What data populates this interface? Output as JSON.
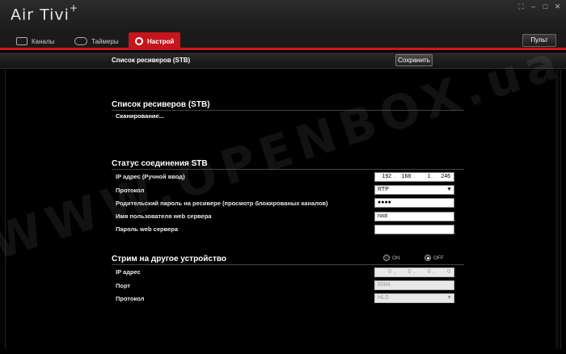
{
  "app": {
    "title": "Air Tivi",
    "title_sup": "+"
  },
  "window_controls": [
    "fullscreen-icon",
    "minimize-icon",
    "maximize-icon",
    "close-icon"
  ],
  "tabs": [
    {
      "label": "Каналы",
      "icon": "tv-icon",
      "active": false
    },
    {
      "label": "Таймеры",
      "icon": "timer-icon",
      "active": false
    },
    {
      "label": "Настрой",
      "icon": "gear-icon",
      "active": true
    }
  ],
  "remote_button": "Пульт",
  "subheader": {
    "title": "Список  ресиверов (STB)",
    "save_label": "Сохранить"
  },
  "receivers": {
    "title": "Список  ресиверов (STB)",
    "status": "Сканирование..."
  },
  "stb_status": {
    "title": "Статус соединения STB",
    "ip_label": "IP адрес (Ручной ввод)",
    "ip": [
      "192",
      "168",
      "1",
      "246"
    ],
    "protocol_label": "Протокол",
    "protocol": "RTP",
    "parental_label": "Родительский пароль на ресивере (просмотр блокированых каналов)",
    "parental_value": "●●●●",
    "user_label": "Имя пользователя web сервера",
    "user_value": "root",
    "pass_label": "Пароль web сервера",
    "pass_value": ""
  },
  "stream": {
    "title": "Стрим на другое устройство",
    "on_label": "ON",
    "off_label": "OFF",
    "selected": "OFF",
    "ip_label": "IP адрес",
    "ip": [
      "0",
      "0",
      "0",
      "0"
    ],
    "port_label": "Порт",
    "port_placeholder": "5004",
    "protocol_label": "Протокол",
    "protocol": "HLS"
  },
  "watermark": "WWW.OPENBOX.ua",
  "colors": {
    "accent": "#c4161c",
    "background": "#000000"
  }
}
